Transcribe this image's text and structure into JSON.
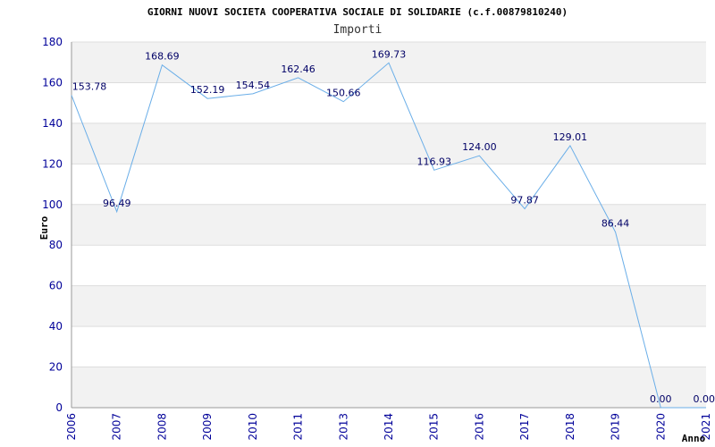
{
  "chart_data": {
    "type": "line",
    "title": "GIORNI NUOVI SOCIETA COOPERATIVA SOCIALE DI SOLIDARIE (c.f.00879810240)",
    "subtitle": "Importi",
    "xlabel": "Anno",
    "ylabel": "Euro",
    "ylim": [
      0,
      180
    ],
    "yticks": [
      "0",
      "20",
      "40",
      "60",
      "80",
      "100",
      "120",
      "140",
      "160",
      "180"
    ],
    "categories": [
      "2006",
      "2007",
      "2008",
      "2009",
      "2010",
      "2011",
      "2013",
      "2014",
      "2015",
      "2016",
      "2017",
      "2018",
      "2019",
      "2020",
      "2021"
    ],
    "values": [
      153.78,
      96.49,
      168.69,
      152.19,
      154.54,
      162.46,
      150.66,
      169.73,
      116.93,
      124.0,
      97.87,
      129.01,
      86.44,
      0.0,
      0.0
    ],
    "labels": [
      "153.78",
      "96.49",
      "168.69",
      "152.19",
      "154.54",
      "162.46",
      "150.66",
      "169.73",
      "116.93",
      "124.00",
      "97.87",
      "129.01",
      "86.44",
      "0.00",
      "0.00"
    ],
    "grid": true,
    "colors": {
      "line": "#6aaee8",
      "band": "#f2f2f2",
      "grid": "#dddddd",
      "tick": "#000099",
      "label": "#000066"
    }
  }
}
